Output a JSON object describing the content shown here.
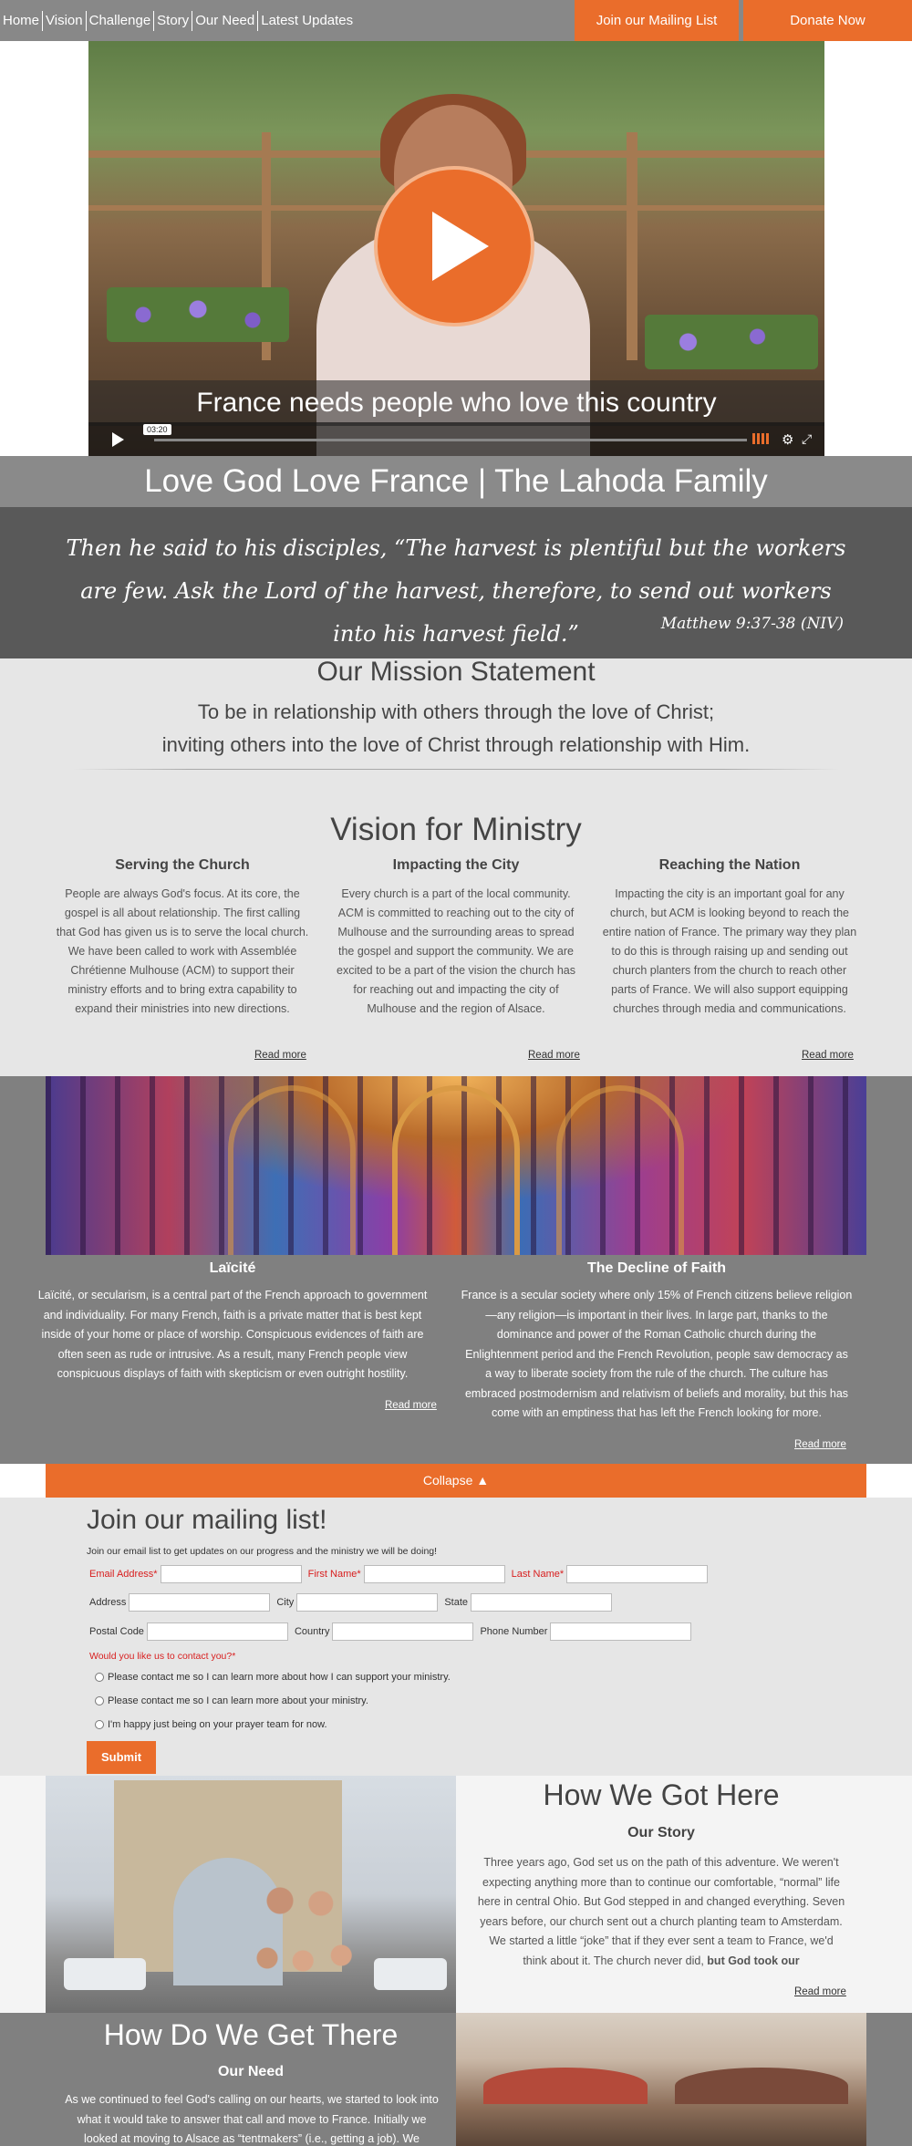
{
  "nav": {
    "links": [
      "Home",
      "Vision",
      "Challenge",
      "Story",
      "Our Need",
      "Latest Updates"
    ],
    "mailing_button": "Join our Mailing List",
    "donate_button": "Donate Now"
  },
  "video": {
    "caption": "France needs people who love this country",
    "time": "03:20"
  },
  "page_title": "Love God Love France | The Lahoda Family",
  "quote": {
    "text": "Then he said to his disciples, “The harvest is plentiful but the workers are few. Ask the Lord of the harvest, therefore, to send out workers into his harvest field.”",
    "reference": "Matthew 9:37-38 (NIV)"
  },
  "mission": {
    "title": "Our Mission Statement",
    "line1": "To be in relationship with others through the love of Christ;",
    "line2": "inviting others into the love of Christ through relationship with Him."
  },
  "vision": {
    "title": "Vision for Ministry",
    "read_more": "Read more",
    "columns": [
      {
        "heading": "Serving the Church",
        "body": "People are always God's focus. At its core, the gospel is all about relationship. The first calling that God has given us is to serve the local church. We have been called to work with Assemblée Chrétienne Mulhouse (ACM) to support their ministry efforts and to bring extra capability to expand their ministries into new directions."
      },
      {
        "heading": "Impacting the City",
        "body": "Every church is a part of the local community. ACM is committed to reaching out to the city of Mulhouse and the surrounding areas to spread the gospel and support the community. We are excited to be a part of the vision the church has for reaching out and impacting the city of Mulhouse and the region of Alsace."
      },
      {
        "heading": "Reaching the Nation",
        "body": "Impacting the city is an important goal for any church, but ACM is looking beyond to reach the entire nation of France. The primary way they plan to do this is through raising up and sending out church planters from the church to reach other parts of France. We will also support equipping churches through media and communications."
      }
    ]
  },
  "challenge": {
    "read_more": "Read more",
    "columns": [
      {
        "heading": "Laïcité",
        "body": "Laïcité, or secularism, is a central part of the French approach to government and individuality. For many French, faith is a private matter that is best kept inside of your home or place of worship. Conspicuous evidences of faith are often seen as rude or intrusive. As a result, many French people view conspicuous displays of faith with skepticism or even outright hostility."
      },
      {
        "heading": "The Decline of Faith",
        "body": "France is a secular society where only 15% of French citizens believe religion—any religion—is important in their lives. In large part, thanks to the dominance and power of the Roman Catholic church during the Enlightenment period and the French Revolution, people saw democracy as a way to liberate society from the rule of the church. The culture has embraced postmodernism and relativism of beliefs and morality, but this has come with an emptiness that has left the French looking for more."
      }
    ]
  },
  "collapse_label": "Collapse ▲",
  "mailing": {
    "title": "Join our mailing list!",
    "subtitle": "Join our email list to get updates on our progress and the ministry we will be doing!",
    "email_label": "Email Address*",
    "first_name_label": "First Name*",
    "last_name_label": "Last Name*",
    "address_label": "Address",
    "city_label": "City",
    "state_label": "State",
    "postal_label": "Postal Code",
    "country_label": "Country",
    "phone_label": "Phone Number",
    "contact_question": "Would you like us to contact you?*",
    "options": [
      "Please contact me so I can learn more about how I can support your ministry.",
      "Please contact me so I can learn more about your ministry.",
      "I'm happy just being on your prayer team for now."
    ],
    "submit": "Submit"
  },
  "story": {
    "title": "How We Got Here",
    "subtitle": "Our Story",
    "body_plain": "Three years ago, God set us on the path of this adventure. We weren't expecting anything more than to continue our comfortable, “normal” life here in central Ohio. But God stepped in and changed everything. Seven years before, our church sent out a church planting team to Amsterdam. We started a little “joke” that if they ever sent a team to France, we'd think about it. The church never did, ",
    "body_bold": "but God took our",
    "read_more": "Read more"
  },
  "need": {
    "title": "How Do We Get There",
    "subtitle": "Our Need",
    "body": "As we continued to feel God's calling on our hearts, we started to look into what it would take to answer that call and move to France. Initially we looked at moving to Alsace as “tentmakers” (i.e., getting a job). We"
  },
  "colors": {
    "accent": "#ea6d2b",
    "nav_bg": "#888888",
    "dark_band": "#595959",
    "light_band": "#e6e6e6",
    "required": "#d81e1e"
  }
}
